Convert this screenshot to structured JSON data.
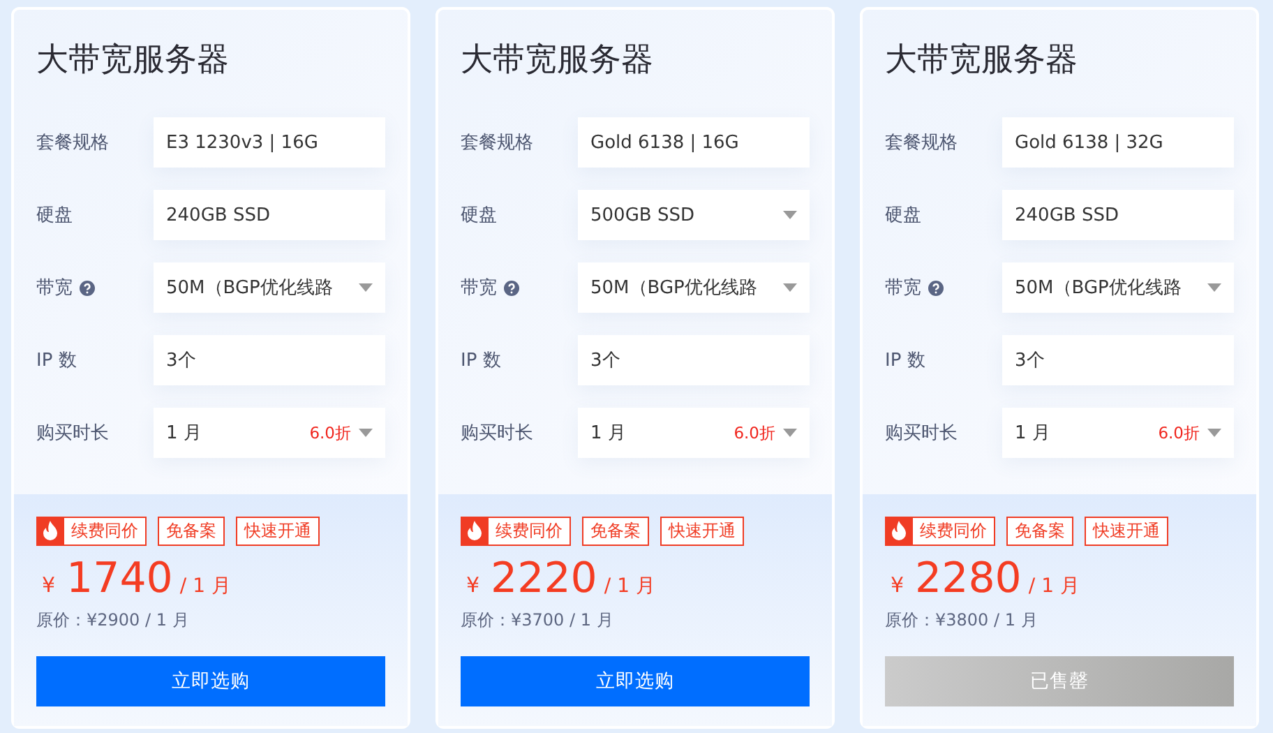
{
  "cards": [
    {
      "title": "大带宽服务器",
      "fields": [
        {
          "label": "套餐规格",
          "value": "E3 1230v3 | 16G",
          "kind": "static",
          "help": false
        },
        {
          "label": "硬盘",
          "value": "240GB SSD",
          "kind": "static",
          "help": false
        },
        {
          "label": "带宽",
          "value": "50M（BGP优化线路",
          "kind": "select",
          "help": true
        },
        {
          "label": "IP 数",
          "value": "3个",
          "kind": "static",
          "help": false
        },
        {
          "label": "购买时长",
          "value": "1 月",
          "kind": "select",
          "help": false,
          "discount": "6.0折"
        }
      ],
      "tags": [
        {
          "label": "续费同价",
          "hot": true
        },
        {
          "label": "免备案",
          "hot": false
        },
        {
          "label": "快速开通",
          "hot": false
        }
      ],
      "currency": "¥",
      "price": "1740",
      "period": "/ 1 月",
      "original_price": "原价：¥2900 / 1 月",
      "button": {
        "label": "立即选购",
        "disabled": false
      }
    },
    {
      "title": "大带宽服务器",
      "fields": [
        {
          "label": "套餐规格",
          "value": "Gold 6138 | 16G",
          "kind": "static",
          "help": false
        },
        {
          "label": "硬盘",
          "value": "500GB SSD",
          "kind": "select",
          "help": false
        },
        {
          "label": "带宽",
          "value": "50M（BGP优化线路",
          "kind": "select",
          "help": true
        },
        {
          "label": "IP 数",
          "value": "3个",
          "kind": "static",
          "help": false
        },
        {
          "label": "购买时长",
          "value": "1 月",
          "kind": "select",
          "help": false,
          "discount": "6.0折"
        }
      ],
      "tags": [
        {
          "label": "续费同价",
          "hot": true
        },
        {
          "label": "免备案",
          "hot": false
        },
        {
          "label": "快速开通",
          "hot": false
        }
      ],
      "currency": "¥",
      "price": "2220",
      "period": "/ 1 月",
      "original_price": "原价：¥3700 / 1 月",
      "button": {
        "label": "立即选购",
        "disabled": false
      }
    },
    {
      "title": "大带宽服务器",
      "fields": [
        {
          "label": "套餐规格",
          "value": "Gold 6138 | 32G",
          "kind": "static",
          "help": false
        },
        {
          "label": "硬盘",
          "value": "240GB SSD",
          "kind": "static",
          "help": false
        },
        {
          "label": "带宽",
          "value": "50M（BGP优化线路",
          "kind": "select",
          "help": true
        },
        {
          "label": "IP 数",
          "value": "3个",
          "kind": "static",
          "help": false
        },
        {
          "label": "购买时长",
          "value": "1 月",
          "kind": "select",
          "help": false,
          "discount": "6.0折"
        }
      ],
      "tags": [
        {
          "label": "续费同价",
          "hot": true
        },
        {
          "label": "免备案",
          "hot": false
        },
        {
          "label": "快速开通",
          "hot": false
        }
      ],
      "currency": "¥",
      "price": "2280",
      "period": "/ 1 月",
      "original_price": "原价：¥3800 / 1 月",
      "button": {
        "label": "已售罄",
        "disabled": true
      }
    }
  ]
}
